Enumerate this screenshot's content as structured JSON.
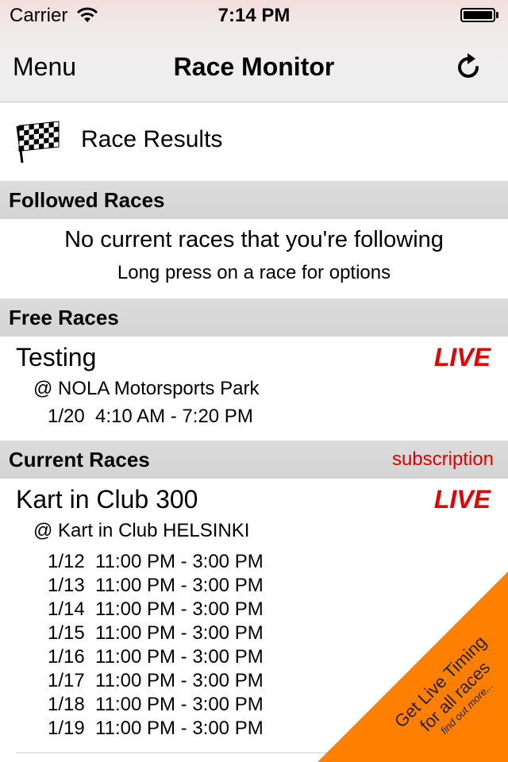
{
  "status_bar": {
    "carrier": "Carrier",
    "time": "7:14 PM"
  },
  "nav": {
    "menu_label": "Menu",
    "title": "Race Monitor",
    "refresh_icon": "refresh-icon"
  },
  "race_results": {
    "label": "Race Results",
    "icon": "checkered-flag-icon"
  },
  "followed": {
    "header": "Followed Races",
    "empty_main": "No current races that you're following",
    "empty_sub": "Long press on a race for options"
  },
  "free": {
    "header": "Free Races",
    "races": [
      {
        "name": "Testing",
        "status": "LIVE",
        "venue": "@ NOLA Motorsports Park",
        "dates": [
          "1/20  4:10 AM - 7:20 PM"
        ]
      }
    ]
  },
  "current": {
    "header": "Current Races",
    "link": "subscription",
    "races": [
      {
        "name": "Kart in Club 300",
        "status": "LIVE",
        "venue": "@ Kart in Club HELSINKI",
        "dates": [
          "1/12  11:00 PM - 3:00 PM",
          "1/13  11:00 PM - 3:00 PM",
          "1/14  11:00 PM - 3:00 PM",
          "1/15  11:00 PM - 3:00 PM",
          "1/16  11:00 PM - 3:00 PM",
          "1/17  11:00 PM - 3:00 PM",
          "1/18  11:00 PM - 3:00 PM",
          "1/19  11:00 PM - 3:00 PM"
        ]
      }
    ]
  },
  "promo": {
    "line1": "Get Live Timing",
    "line2": "for all races",
    "line3": "find out more...",
    "color": "#ff7f00"
  },
  "colors": {
    "live": "#e60000",
    "link": "#e00000"
  }
}
